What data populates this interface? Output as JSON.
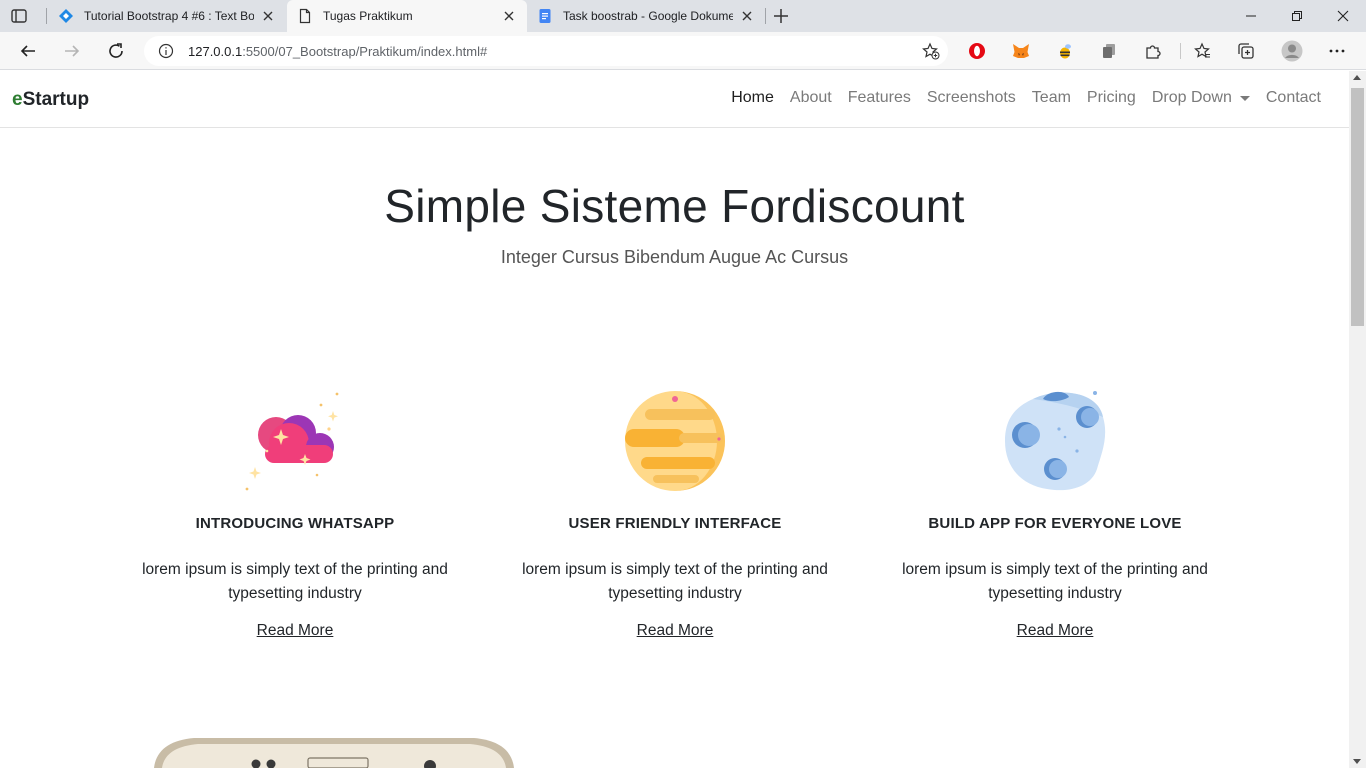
{
  "browser": {
    "tabs": [
      {
        "title": "Tutorial Bootstrap 4 #6 : Text Bo",
        "icon": "vscode-icon",
        "active": false
      },
      {
        "title": "Tugas Praktikum",
        "icon": "page-icon",
        "active": true
      },
      {
        "title": "Task boostrab - Google Dokume",
        "icon": "google-docs-icon",
        "active": false
      }
    ],
    "address": {
      "host": "127.0.0.1",
      "path": ":5500/07_Bootstrap/Praktikum/index.html#"
    }
  },
  "navbar": {
    "brand_accent": "e",
    "brand_rest": "Startup",
    "links": [
      "Home",
      "About",
      "Features",
      "Screenshots",
      "Team",
      "Pricing",
      "Drop Down",
      "Contact"
    ]
  },
  "hero": {
    "title": "Simple Sisteme Fordiscount",
    "subtitle": "Integer Cursus Bibendum Augue Ac Cursus"
  },
  "features": [
    {
      "title": "INTRODUCING WHATSAPP",
      "text": "lorem ipsum is simply text of the printing and typesetting industry",
      "link": "Read More",
      "icon": "cloud-sparkle-icon"
    },
    {
      "title": "USER FRIENDLY INTERFACE",
      "text": "lorem ipsum is simply text of the printing and typesetting industry",
      "link": "Read More",
      "icon": "planet-icon"
    },
    {
      "title": "BUILD APP FOR EVERYONE LOVE",
      "text": "lorem ipsum is simply text of the printing and typesetting industry",
      "link": "Read More",
      "icon": "moon-icon"
    }
  ],
  "colors": {
    "brand_accent": "#2e7d32",
    "text": "#212529",
    "nav_muted": "#7a7a7a"
  }
}
